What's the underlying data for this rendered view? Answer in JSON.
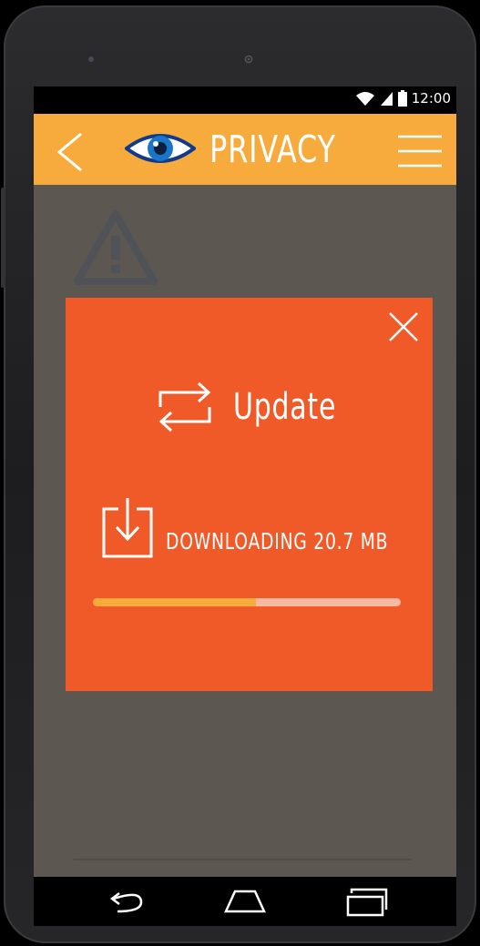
{
  "status_bar": {
    "time": "12:00",
    "icons": [
      "wifi-icon",
      "signal-icon",
      "battery-icon"
    ]
  },
  "app_bar": {
    "title": "PRIVACY",
    "icons": [
      "back-arrow-icon",
      "eye-icon",
      "menu-icon"
    ]
  },
  "modal": {
    "title": "Update",
    "download_status": "DOWNLOADING 20.7 MB",
    "progress_fraction": 0.53,
    "icons": [
      "close-icon",
      "sync-icon",
      "download-icon"
    ]
  },
  "nav_bar": {
    "icons": [
      "nav-back-icon",
      "nav-home-icon",
      "nav-recents-icon"
    ]
  },
  "colors": {
    "app_bar": "#f7ab3d",
    "modal": "#f05a29",
    "progress_fill": "#f7ab3d",
    "progress_track": "#f6b9a2",
    "background_overlay": "#5c5751"
  }
}
